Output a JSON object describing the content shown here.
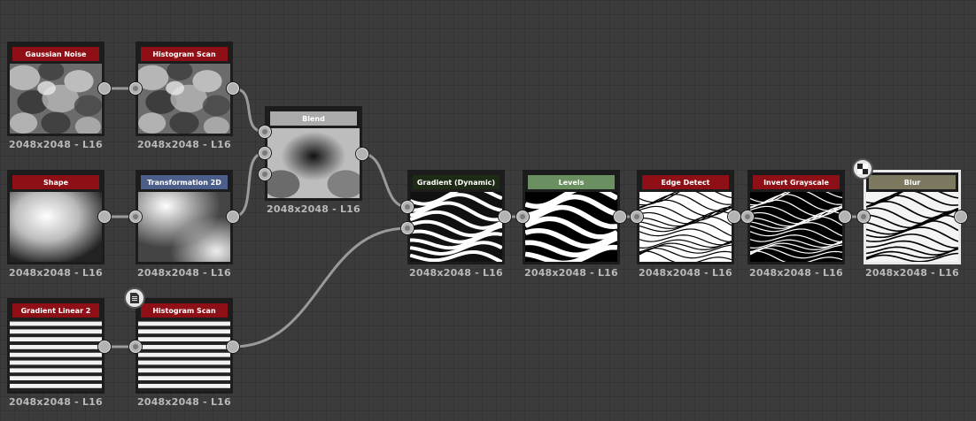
{
  "colors": {
    "header_red": "#8e1016",
    "header_blue": "#4c5f8a",
    "header_gray": "#aaaaaa",
    "header_dark": "#1d2a14",
    "header_green": "#6a8f60",
    "header_tan": "#7d7860",
    "wire": "#9a9a9a"
  },
  "nodes": [
    {
      "id": "gaussian_noise",
      "title": "Gaussian Noise",
      "label": "2048x2048 - L16",
      "header": "red",
      "thumb": "noise"
    },
    {
      "id": "histogram_scan_1",
      "title": "Histogram Scan",
      "label": "2048x2048 - L16",
      "header": "red",
      "thumb": "noise"
    },
    {
      "id": "shape",
      "title": "Shape",
      "label": "2048x2048 - L16",
      "header": "red",
      "thumb": "shape"
    },
    {
      "id": "transformation_2d",
      "title": "Transformation 2D",
      "label": "2048x2048 - L16",
      "header": "blue",
      "thumb": "transform"
    },
    {
      "id": "blend",
      "title": "Blend",
      "label": "2048x2048 - L16",
      "header": "gray",
      "thumb": "blend"
    },
    {
      "id": "gradient_linear_2",
      "title": "Gradient Linear 2",
      "label": "2048x2048 - L16",
      "header": "red",
      "thumb": "stripes"
    },
    {
      "id": "histogram_scan_2",
      "title": "Histogram Scan",
      "label": "2048x2048 - L16",
      "header": "red",
      "thumb": "stripes"
    },
    {
      "id": "gradient_dynamic",
      "title": "Gradient (Dynamic)",
      "label": "2048x2048 - L16",
      "header": "dark",
      "thumb": "gradient"
    },
    {
      "id": "levels",
      "title": "Levels",
      "label": "2048x2048 - L16",
      "header": "green",
      "thumb": "levels"
    },
    {
      "id": "edge_detect",
      "title": "Edge Detect",
      "label": "2048x2048 - L16",
      "header": "red",
      "thumb": "edges"
    },
    {
      "id": "invert_grayscale",
      "title": "Invert Grayscale",
      "label": "2048x2048 - L16",
      "header": "red",
      "thumb": "invert"
    },
    {
      "id": "blur",
      "title": "Blur",
      "label": "2048x2048 - L16",
      "header": "tan",
      "thumb": "blur",
      "selected": true
    }
  ],
  "badges": [
    {
      "id": "comment_badge",
      "icon": "document-icon"
    },
    {
      "id": "output_badge",
      "icon": "checker-icon"
    }
  ]
}
